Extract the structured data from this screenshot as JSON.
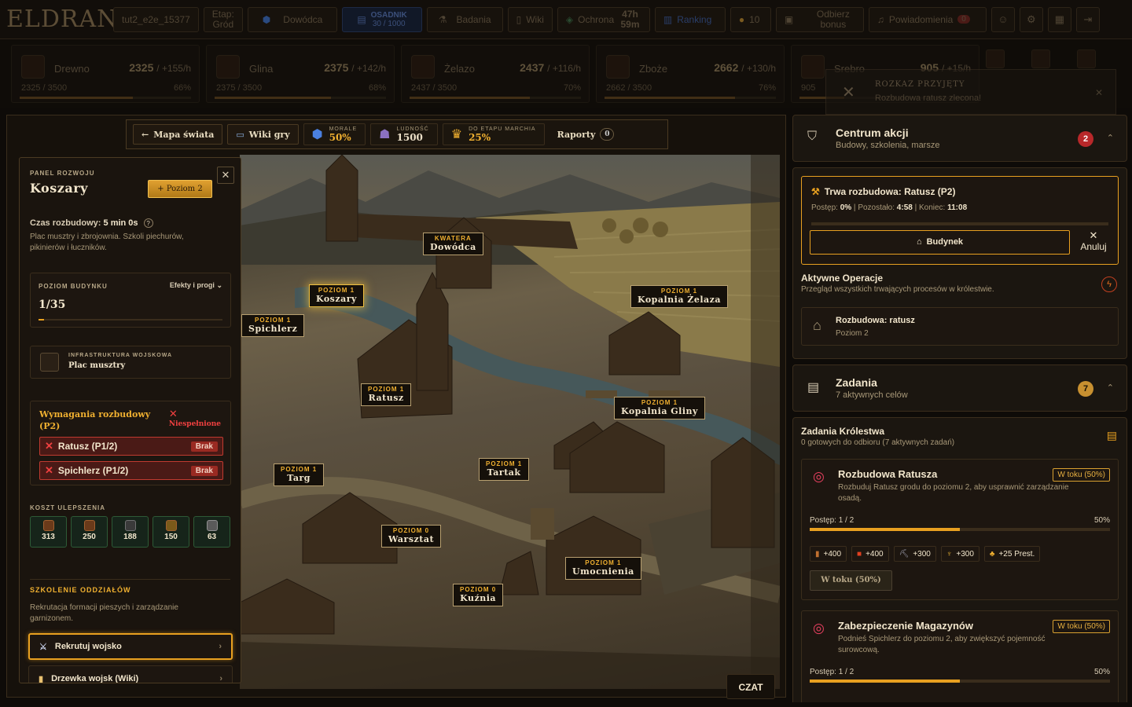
{
  "topbar": {
    "logo": "ELDRAN",
    "username": "tut2_e2e_15377",
    "stage_label": "Etap:",
    "stage_value": "Gród",
    "commander": "Dowódca",
    "settler_label": "OSADNIK",
    "settler_value": "30 / 1000",
    "research": "Badania",
    "wiki": "Wiki",
    "protection": "Ochrona",
    "protection_time": "47h 59m",
    "ranking": "Ranking",
    "gold": "10",
    "bonus": "Odbierz bonus",
    "notifications": "Powiadomienia",
    "notifications_count": "0"
  },
  "resources": [
    {
      "name": "Drewno",
      "amount": "2325",
      "rate": "/ +155/h",
      "cap": "2325 / 3500",
      "pct": "66%",
      "fill": 0.66
    },
    {
      "name": "Glina",
      "amount": "2375",
      "rate": "/ +142/h",
      "cap": "2375 / 3500",
      "pct": "68%",
      "fill": 0.68
    },
    {
      "name": "Żelazo",
      "amount": "2437",
      "rate": "/ +116/h",
      "cap": "2437 / 3500",
      "pct": "70%",
      "fill": 0.7
    },
    {
      "name": "Zboże",
      "amount": "2662",
      "rate": "/ +130/h",
      "cap": "2662 / 3500",
      "pct": "76%",
      "fill": 0.76
    },
    {
      "name": "Srebro",
      "amount": "905",
      "rate": "/ +15/h",
      "cap": "905",
      "pct": "",
      "fill": 0.26
    }
  ],
  "toast": {
    "title": "ROZKAZ PRZYJĘTY",
    "text": "Rozbudowa ratusz zlecona!"
  },
  "mapnav": {
    "world_map": "Mapa świata",
    "wiki_game": "Wiki gry",
    "morale_label": "MORALE",
    "morale_value": "50%",
    "population_label": "LUDNOŚĆ",
    "population_value": "1500",
    "stage_label": "DO ETAPU MARCHIA",
    "stage_value": "25%",
    "reports": "Raporty",
    "reports_count": "0"
  },
  "map_labels": [
    {
      "level": "KWATERA",
      "name": "Dowódca"
    },
    {
      "level": "POZIOM 1",
      "name": "Koszary"
    },
    {
      "level": "POZIOM 1",
      "name": "Spichlerz"
    },
    {
      "level": "POZIOM 1",
      "name": "Kopalnia Żelaza"
    },
    {
      "level": "POZIOM 1",
      "name": "Ratusz"
    },
    {
      "level": "POZIOM 1",
      "name": "Kopalnia Gliny"
    },
    {
      "level": "POZIOM 1",
      "name": "Targ"
    },
    {
      "level": "POZIOM 1",
      "name": "Tartak"
    },
    {
      "level": "POZIOM 0",
      "name": "Warsztat"
    },
    {
      "level": "POZIOM 1",
      "name": "Umocnienia"
    },
    {
      "level": "POZIOM 0",
      "name": "Kuźnia"
    }
  ],
  "chat": "CZAT",
  "devpanel": {
    "label": "PANEL ROZWOJU",
    "title": "Koszary",
    "level_button": "+ Poziom 2",
    "time_label": "Czas rozbudowy:",
    "time_value": "5 min 0s",
    "description": "Plac musztry i zbrojownia. Szkoli piechurów, pikinierów i łuczników.",
    "building_level_label": "POZIOM BUDYNKU",
    "effects_label": "Efekty i progi",
    "level_value": "1/35",
    "level_fill": 0.03,
    "infra_label": "INFRASTRUKTURA WOJSKOWA",
    "infra_name": "Plac musztry",
    "req_title": "Wymagania rozbudowy (P2)",
    "req_status": "Niespełnione",
    "requirements": [
      {
        "name": "Ratusz (P1/2)",
        "tag": "Brak"
      },
      {
        "name": "Spichlerz (P1/2)",
        "tag": "Brak"
      }
    ],
    "cost_label": "KOSZT ULEPSZENIA",
    "costs": [
      "313",
      "250",
      "188",
      "150",
      "63"
    ],
    "training_label": "SZKOLENIE ODDZIAŁÓW",
    "training_desc": "Rekrutacja formacji pieszych i zarządzanie garnizonem.",
    "recruit": "Rekrutuj wojsko",
    "tree": "Drzewka wojsk (Wiki)"
  },
  "action_center": {
    "title": "Centrum akcji",
    "subtitle": "Budowy, szkolenia, marsze",
    "count": "2",
    "construction_title": "Trwa rozbudowa: Ratusz (P2)",
    "progress_label": "Postęp:",
    "progress_value": "0%",
    "remaining_label": "Pozostało:",
    "remaining_value": "4:58",
    "end_label": "Koniec:",
    "end_value": "11:08",
    "construction_fill": 0.0,
    "building_button": "Budynek",
    "cancel_button": "Anuluj",
    "active_title": "Aktywne Operacje",
    "active_subtitle": "Przegląd wszystkich trwających procesów w królestwie.",
    "operation_title": "Rozbudowa: ratusz",
    "operation_sub": "Poziom 2"
  },
  "tasks": {
    "title": "Zadania",
    "subtitle": "7 aktywnych celów",
    "count": "7",
    "kingdom_title": "Zadania Królestwa",
    "kingdom_sub": "0 gotowych do odbioru (7 aktywnych zadań)",
    "items": [
      {
        "title": "Rozbudowa Ratusza",
        "status": "W toku (50%)",
        "desc": "Rozbuduj Ratusz grodu do poziomu 2, aby usprawnić zarządzanie osadą.",
        "progress": "Postęp: 1 / 2",
        "pct": "50%",
        "fill": 0.5,
        "rewards": [
          "+400",
          "+400",
          "+300",
          "+300",
          "+25 Prest."
        ],
        "button": "W toku (50%)"
      },
      {
        "title": "Zabezpieczenie Magazynów",
        "status": "W toku (50%)",
        "desc": "Podnieś Spichlerz do poziomu 2, aby zwiększyć pojemność surowcową.",
        "progress": "Postęp: 1 / 2",
        "pct": "50%",
        "fill": 0.5
      }
    ]
  },
  "colors": {
    "accent": "#e8a020",
    "danger": "#c03a30",
    "success": "#2d5a36"
  }
}
